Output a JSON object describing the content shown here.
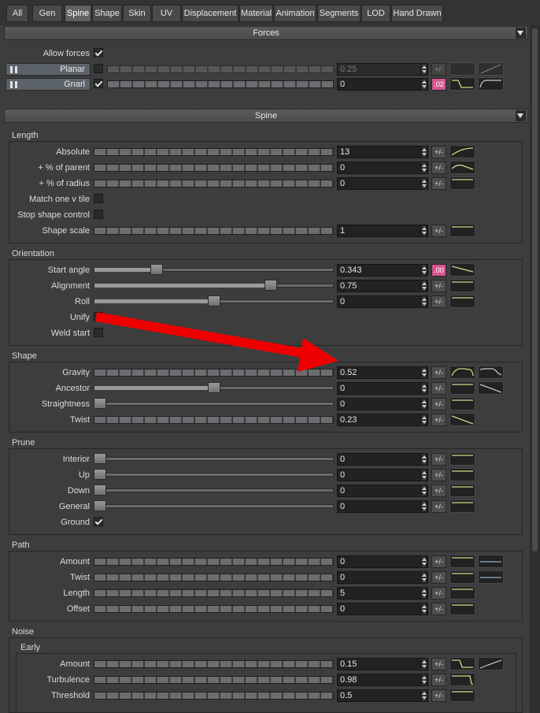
{
  "tabs": [
    "All",
    "Gen",
    "Spine",
    "Shape",
    "Skin",
    "UV",
    "Displacement",
    "Material",
    "Animation",
    "Segments",
    "LOD",
    "Hand Drawn"
  ],
  "active_tab": "Spine",
  "headers": {
    "forces": "Forces",
    "spine": "Spine"
  },
  "forces": {
    "allow_forces": "Allow forces",
    "planar": {
      "label": "Planar",
      "value": "0.25",
      "pm": "+/-"
    },
    "gnarl": {
      "label": "Gnarl",
      "value": "0",
      "pm": ".02"
    }
  },
  "groups": {
    "length": "Length",
    "orientation": "Orientation",
    "shape": "Shape",
    "prune": "Prune",
    "path": "Path",
    "noise": "Noise",
    "early": "Early"
  },
  "length": {
    "absolute": {
      "label": "Absolute",
      "value": "13",
      "pm": "+/-"
    },
    "pct_parent": {
      "label": "+ % of parent",
      "value": "0",
      "pm": "+/-"
    },
    "pct_radius": {
      "label": "+ % of radius",
      "value": "0",
      "pm": "+/-"
    },
    "match_v_tile": "Match one v tile",
    "stop_shape": "Stop shape control",
    "shape_scale": {
      "label": "Shape scale",
      "value": "1",
      "pm": "+/-"
    }
  },
  "orientation": {
    "start_angle": {
      "label": "Start angle",
      "value": "0.343",
      "pm": ".00",
      "level": 0.25
    },
    "alignment": {
      "label": "Alignment",
      "value": "0.75",
      "pm": "+/-",
      "level": 0.75
    },
    "roll": {
      "label": "Roll",
      "value": "0",
      "pm": "+/-",
      "level": 0.5
    },
    "unify": "Unify",
    "weld_start": "Weld start"
  },
  "shape": {
    "gravity": {
      "label": "Gravity",
      "value": "0.52",
      "pm": "+/-"
    },
    "ancestor": {
      "label": "Ancestor",
      "value": "0",
      "pm": "+/-",
      "level": 0.5
    },
    "straightness": {
      "label": "Straightness",
      "value": "0",
      "pm": "+/-",
      "level": 0
    },
    "twist": {
      "label": "Twist",
      "value": "0.23",
      "pm": "+/-"
    }
  },
  "prune": {
    "interior": {
      "label": "Interior",
      "value": "0",
      "pm": "+/-"
    },
    "up": {
      "label": "Up",
      "value": "0",
      "pm": "+/-"
    },
    "down": {
      "label": "Down",
      "value": "0",
      "pm": "+/-"
    },
    "general": {
      "label": "General",
      "value": "0",
      "pm": "+/-"
    },
    "ground": "Ground"
  },
  "path": {
    "amount": {
      "label": "Amount",
      "value": "0",
      "pm": "+/-"
    },
    "twist": {
      "label": "Twist",
      "value": "0",
      "pm": "+/-"
    },
    "length": {
      "label": "Length",
      "value": "5",
      "pm": "+/-"
    },
    "offset": {
      "label": "Offset",
      "value": "0",
      "pm": "+/-"
    }
  },
  "noise_early": {
    "amount": {
      "label": "Amount",
      "value": "0.15",
      "pm": "+/-"
    },
    "turbulence": {
      "label": "Turbulence",
      "value": "0.98",
      "pm": "+/-"
    },
    "threshold": {
      "label": "Threshold",
      "value": "0.5",
      "pm": "+/-"
    }
  },
  "colors": {
    "accent_pink": "#d55790",
    "curve_green": "#c8dc8a",
    "arrow_red": "#ee0000"
  }
}
